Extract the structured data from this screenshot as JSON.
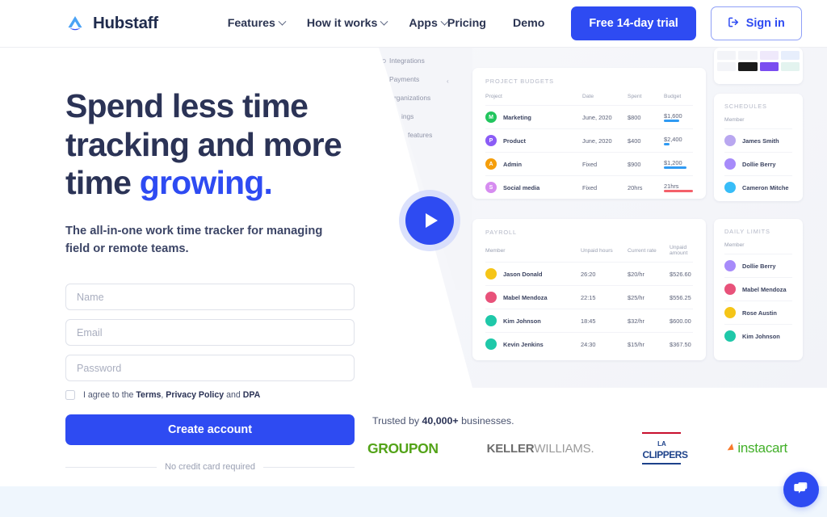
{
  "nav": {
    "brand": "Hubstaff",
    "links": [
      {
        "label": "Features",
        "has_caret": true
      },
      {
        "label": "How it works",
        "has_caret": true
      },
      {
        "label": "Apps",
        "has_caret": true
      }
    ],
    "plain_links": [
      {
        "label": "Pricing"
      },
      {
        "label": "Demo"
      }
    ],
    "trial_button": "Free 14-day trial",
    "signin_button": "Sign in"
  },
  "hero": {
    "headline_line1": "Spend less time",
    "headline_line2": "tracking and more",
    "headline_line3_prefix": "time ",
    "headline_accent": "growing.",
    "subhead": "The all-in-one work time tracker for managing field or remote teams.",
    "form": {
      "name_placeholder": "Name",
      "email_placeholder": "Email",
      "password_placeholder": "Password",
      "name_value": "",
      "email_value": "",
      "password_value": "",
      "agree_prefix": "I agree to the ",
      "agree_terms": "Terms",
      "agree_sep1": ", ",
      "agree_privacy": "Privacy Policy",
      "agree_sep2": " and ",
      "agree_dpa": "DPA",
      "submit_label": "Create account",
      "no_credit_card": "No credit card required"
    }
  },
  "mock": {
    "sidebar": [
      {
        "label": "Integrations"
      },
      {
        "label": "Payments"
      },
      {
        "label": "rganizations"
      },
      {
        "label": "ings"
      },
      {
        "label": "features"
      }
    ],
    "project_budgets": {
      "title": "PROJECT BUDGETS",
      "columns": [
        "Project",
        "Date",
        "Spent",
        "Budget"
      ],
      "rows": [
        {
          "initial": "M",
          "color": "#22c55e",
          "project": "Marketing",
          "date": "June, 2020",
          "spent": "$800",
          "budget": "$1,600",
          "bar_pct": 52,
          "bar_color": "#2f9af3"
        },
        {
          "initial": "P",
          "color": "#8b5cf6",
          "project": "Product",
          "date": "June, 2020",
          "spent": "$400",
          "budget": "$2,400",
          "bar_pct": 20,
          "bar_color": "#2f9af3"
        },
        {
          "initial": "A",
          "color": "#f59e0b",
          "project": "Admin",
          "date": "Fixed",
          "spent": "$900",
          "budget": "$1,200",
          "bar_pct": 78,
          "bar_color": "#2f9af3"
        },
        {
          "initial": "S",
          "color": "#d68cf0",
          "project": "Social media",
          "date": "Fixed",
          "spent": "20hrs",
          "budget": "21hrs",
          "bar_pct": 100,
          "bar_color": "#f4606a"
        }
      ]
    },
    "payroll": {
      "title": "PAYROLL",
      "columns": [
        "Member",
        "Unpaid hours",
        "Current rate",
        "Unpaid amount"
      ],
      "rows": [
        {
          "member": "Jason Donald",
          "color": "#f5c518",
          "hours": "26:20",
          "rate": "$20/hr",
          "amount": "$526.60"
        },
        {
          "member": "Mabel Mendoza",
          "color": "#e8527a",
          "hours": "22:15",
          "rate": "$25/hr",
          "amount": "$556.25"
        },
        {
          "member": "Kim Johnson",
          "color": "#1fc8a9",
          "hours": "18:45",
          "rate": "$32/hr",
          "amount": "$600.00"
        },
        {
          "member": "Kevin Jenkins",
          "color": "#1fc8a9",
          "hours": "24:30",
          "rate": "$15/hr",
          "amount": "$367.50"
        }
      ]
    },
    "schedules": {
      "title": "SCHEDULES",
      "column": "Member",
      "rows": [
        {
          "name": "James Smith",
          "color": "#b9a7f0"
        },
        {
          "name": "Dollie Berry",
          "color": "#a78bfa"
        },
        {
          "name": "Cameron Mitche",
          "color": "#38bdf8"
        }
      ]
    },
    "daily_limits": {
      "title": "DAILY LIMITS",
      "column": "Member",
      "rows": [
        {
          "name": "Dollie Berry",
          "color": "#a78bfa"
        },
        {
          "name": "Mabel Mendoza",
          "color": "#e8527a"
        },
        {
          "name": "Rose Austin",
          "color": "#f5c518"
        },
        {
          "name": "Kim Johnson",
          "color": "#1fc8a9"
        }
      ]
    },
    "play_button": "play-video"
  },
  "trust": {
    "prefix": "Trusted by ",
    "count": "40,000+",
    "suffix": " businesses.",
    "logos": [
      {
        "name": "GROUPON"
      },
      {
        "name": "KELLERWILLIAMS."
      },
      {
        "name": "CLIPPERS"
      },
      {
        "name": "instacart"
      }
    ],
    "kw_bold": "KELLER",
    "kw_light": "WILLIAMS.",
    "clippers_badge": "LA",
    "clippers_word": "CLIPPERS",
    "instacart_word": "instacart"
  },
  "colors": {
    "brand_blue": "#2e4bf2",
    "headline_navy": "#2b3356",
    "groupon_green": "#53a318",
    "instacart_green": "#43b02a"
  },
  "chat": {
    "label": "chat-widget"
  }
}
